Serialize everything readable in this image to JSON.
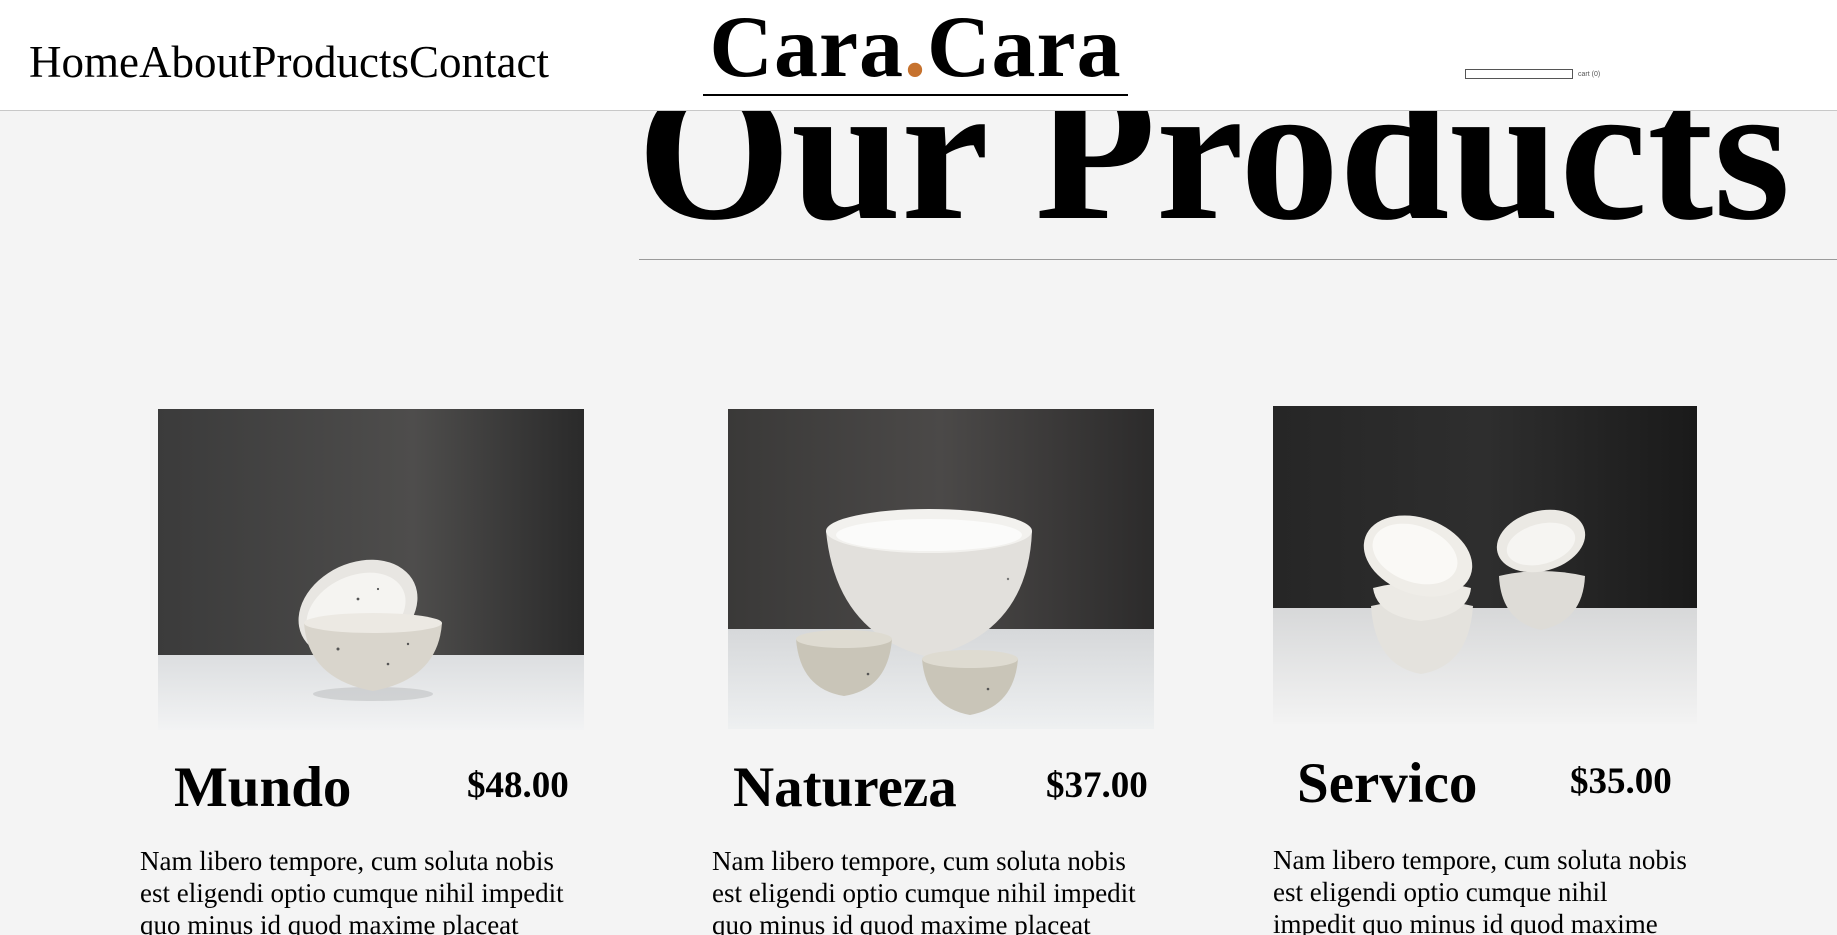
{
  "header": {
    "nav": [
      "Home",
      "About",
      "Products",
      "Contact"
    ],
    "logo": {
      "left": "Cara",
      "dot": ".",
      "right": "Cara"
    },
    "search": {
      "placeholder": "",
      "value": ""
    },
    "cart_label": "cart (0)"
  },
  "main": {
    "page_title": "Our Products",
    "products": [
      {
        "name": "Mundo",
        "price": "$48.00",
        "description": "Nam libero tempore, cum soluta nobis est eligendi optio cumque nihil impedit quo minus id quod maxime placeat"
      },
      {
        "name": "Natureza",
        "price": "$37.00",
        "description": "Nam libero tempore, cum soluta nobis est eligendi optio cumque nihil impedit quo minus id quod maxime placeat"
      },
      {
        "name": "Servico",
        "price": "$35.00",
        "description": "Nam libero tempore, cum soluta nobis est eligendi optio cumque nihil impedit quo minus id quod maxime"
      }
    ]
  },
  "colors": {
    "background": "#f4f4f4",
    "header": "#ffffff",
    "logo_dot": "#c6722e"
  }
}
